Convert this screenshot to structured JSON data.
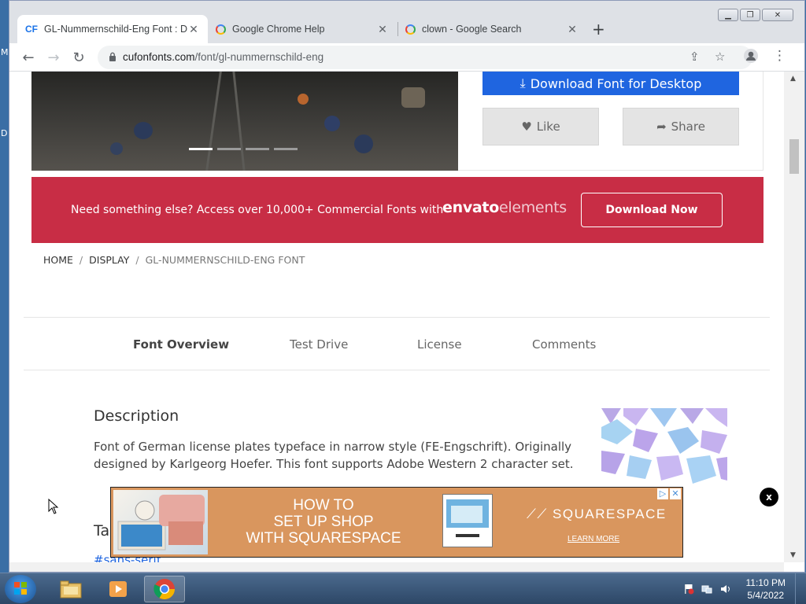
{
  "browser": {
    "tabs": [
      {
        "title": "GL-Nummernschild-Eng Font : D",
        "favicon": "cf-favicon"
      },
      {
        "title": "Google Chrome Help",
        "favicon": "google-favicon"
      },
      {
        "title": "clown - Google Search",
        "favicon": "google-favicon"
      }
    ],
    "url_host": "cufonfonts.com",
    "url_path": "/font/gl-nummernschild-eng"
  },
  "side": {
    "download_label": "Download Font for Desktop",
    "like_label": "Like",
    "share_label": "Share"
  },
  "banner": {
    "text": "Need something else? Access over 10,000+ Commercial Fonts with",
    "brand_bold": "envato",
    "brand_light": "elements",
    "button_label": "Download Now",
    "color": "#c82d45"
  },
  "breadcrumb": {
    "home": "HOME",
    "display": "DISPLAY",
    "current": "GL-NUMMERNSCHILD-ENG FONT"
  },
  "page_tabs": [
    "Font Overview",
    "Test Drive",
    "License",
    "Comments"
  ],
  "description": {
    "heading": "Description",
    "text": "Font of German license plates typeface in narrow style (FE-Engschrift). Originally designed by Karlgeorg Hoefer. This font supports Adobe Western 2 character set."
  },
  "tags": {
    "heading": "Ta",
    "first": "#sans-serif"
  },
  "ad": {
    "headline": [
      "HOW TO",
      "SET UP SHOP",
      "WITH SQUARESPACE"
    ],
    "brand": "SQUARESPACE",
    "cta": "LEARN MORE",
    "close": "x"
  },
  "taskbar": {
    "time": "11:10 PM",
    "date": "5/4/2022"
  },
  "desktop": {
    "left_letters": [
      "M",
      "D"
    ]
  }
}
